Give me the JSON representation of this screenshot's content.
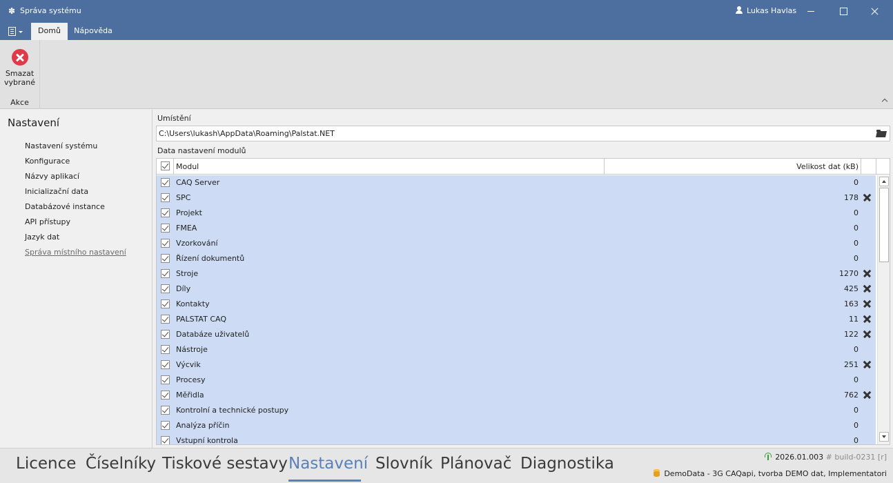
{
  "window": {
    "title": "Správa systému",
    "user": "Lukas Havlas"
  },
  "ribbon_tabs": {
    "home": "Domů",
    "help": "Nápověda"
  },
  "ribbon": {
    "delete_label": "Smazat\nvybrané",
    "group_label": "Akce"
  },
  "nav": {
    "title": "Nastavení",
    "items": [
      "Nastavení systému",
      "Konfigurace",
      "Názvy aplikací",
      "Inicializační data",
      "Databázové instance",
      "API přístupy",
      "Jazyk dat",
      "Správa místního nastavení"
    ],
    "selected_index": 7
  },
  "content": {
    "location_label": "Umístění",
    "path": "C:\\Users\\lukash\\AppData\\Roaming\\Palstat.NET",
    "data_label": "Data nastavení modulů",
    "columns": {
      "module": "Modul",
      "size": "Velikost dat (kB)"
    },
    "rows": [
      {
        "name": "CAQ Server",
        "size": "0",
        "deletable": false
      },
      {
        "name": "SPC",
        "size": "178",
        "deletable": true
      },
      {
        "name": "Projekt",
        "size": "0",
        "deletable": false
      },
      {
        "name": "FMEA",
        "size": "0",
        "deletable": false
      },
      {
        "name": "Vzorkování",
        "size": "0",
        "deletable": false
      },
      {
        "name": "Řízení dokumentů",
        "size": "0",
        "deletable": false
      },
      {
        "name": "Stroje",
        "size": "1270",
        "deletable": true
      },
      {
        "name": "Díly",
        "size": "425",
        "deletable": true
      },
      {
        "name": "Kontakty",
        "size": "163",
        "deletable": true
      },
      {
        "name": "PALSTAT CAQ",
        "size": "11",
        "deletable": true
      },
      {
        "name": "Databáze uživatelů",
        "size": "122",
        "deletable": true
      },
      {
        "name": "Nástroje",
        "size": "0",
        "deletable": false
      },
      {
        "name": "Výcvik",
        "size": "251",
        "deletable": true
      },
      {
        "name": "Procesy",
        "size": "0",
        "deletable": false
      },
      {
        "name": "Měřidla",
        "size": "762",
        "deletable": true
      },
      {
        "name": "Kontrolní a technické postupy",
        "size": "0",
        "deletable": false
      },
      {
        "name": "Analýza příčin",
        "size": "0",
        "deletable": false
      },
      {
        "name": "Vstupní kontrola",
        "size": "0",
        "deletable": false
      }
    ]
  },
  "modules": [
    {
      "label": "Licence",
      "active": false
    },
    {
      "label": "Číselníky",
      "active": false
    },
    {
      "label": "Tiskové sestavy",
      "active": false
    },
    {
      "label": "Nastavení",
      "active": true
    },
    {
      "label": "Slovník",
      "active": false
    },
    {
      "label": "Plánovač",
      "active": false
    },
    {
      "label": "Diagnostika",
      "active": false
    }
  ],
  "status": {
    "version": "2026.01.003",
    "build": "# build-0231 [r]",
    "database": "DemoData - 3G CAQapi, tvorba DEMO dat, Implementatori"
  },
  "colors": {
    "titlebar": "#4d6f9f",
    "selection": "#cddcf4",
    "active_module": "#5a80b8",
    "delete_icon": "#e0394a"
  },
  "icons": [
    "gear-icon",
    "user-icon",
    "list-menu-icon",
    "delete-circle-icon",
    "folder-open-icon",
    "check-icon",
    "close-x-icon",
    "antenna-icon",
    "database-icon"
  ]
}
